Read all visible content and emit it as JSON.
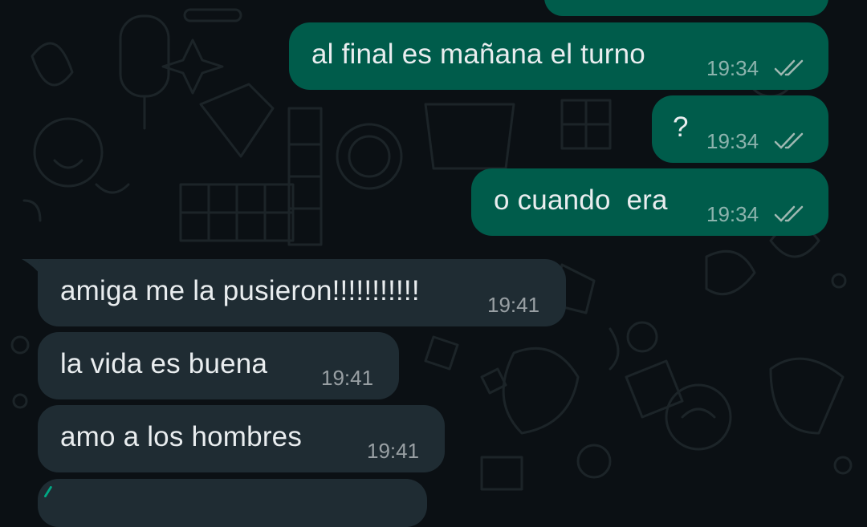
{
  "colors": {
    "background": "#0b1014",
    "outgoing_bubble": "#005c4b",
    "incoming_bubble": "#1f2c33",
    "text": "#e9edef",
    "meta": "#8aa6a0",
    "read_ticks": "#9fb8b2"
  },
  "messages": [
    {
      "direction": "outgoing",
      "text": "al final es mañana el turno",
      "time": "19:34",
      "status": "read-double-tick-icon"
    },
    {
      "direction": "outgoing",
      "text": "?",
      "time": "19:34",
      "status": "read-double-tick-icon"
    },
    {
      "direction": "outgoing",
      "text": "o cuando  era",
      "time": "19:34",
      "status": "read-double-tick-icon"
    },
    {
      "direction": "incoming",
      "text": "amiga me la pusieron!!!!!!!!!!!",
      "time": "19:41"
    },
    {
      "direction": "incoming",
      "text": "la vida es buena",
      "time": "19:41"
    },
    {
      "direction": "incoming",
      "text": "amo a los hombres",
      "time": "19:41"
    }
  ]
}
